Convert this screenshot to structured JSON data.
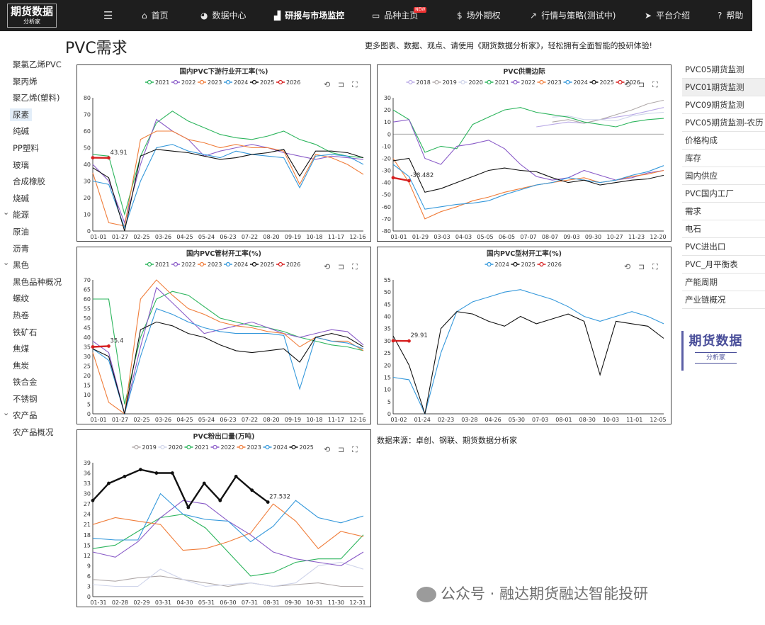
{
  "brand": {
    "line1": "期货数据",
    "line2": "分析家"
  },
  "nav": {
    "menu_icon": "hamburger-icon",
    "items": [
      {
        "label": "首页",
        "icon": "home-icon",
        "glyph": "⌂",
        "left": 200
      },
      {
        "label": "数据中心",
        "icon": "pie-icon",
        "glyph": "◕",
        "left": 283
      },
      {
        "label": "研报与市场监控",
        "icon": "bar-icon",
        "glyph": "▟",
        "left": 387
      },
      {
        "label": "品种主页",
        "icon": "book-icon",
        "glyph": "▭",
        "left": 525
      },
      {
        "label": "场外期权",
        "icon": "dollar-icon",
        "glyph": "$",
        "left": 645
      },
      {
        "label": "行情与策略(测试中)",
        "icon": "trend-icon",
        "glyph": "↗",
        "left": 748
      },
      {
        "label": "平台介绍",
        "icon": "send-icon",
        "glyph": "➤",
        "left": 910
      },
      {
        "label": "帮助",
        "icon": "help-icon",
        "glyph": "?",
        "left": 1013
      }
    ],
    "badge": "NEW"
  },
  "page": {
    "title": "PVC需求",
    "promo": "更多图表、数据、观点、请使用《期货数据分析家》，轻松拥有全面智能的投研体验!"
  },
  "left_nav": [
    {
      "label": "聚氯乙烯PVC"
    },
    {
      "label": "聚丙烯"
    },
    {
      "label": "聚乙烯(塑料)"
    },
    {
      "label": "尿素",
      "active": true
    },
    {
      "label": "纯碱"
    },
    {
      "label": "PP塑料"
    },
    {
      "label": "玻璃"
    },
    {
      "label": "合成橡胶"
    },
    {
      "label": "烧碱"
    },
    {
      "label": "能源",
      "group": true
    },
    {
      "label": "原油"
    },
    {
      "label": "沥青"
    },
    {
      "label": "黑色",
      "group": true
    },
    {
      "label": "黑色品种概况"
    },
    {
      "label": "螺纹"
    },
    {
      "label": "热卷"
    },
    {
      "label": "铁矿石"
    },
    {
      "label": "焦煤"
    },
    {
      "label": "焦炭"
    },
    {
      "label": "铁合金"
    },
    {
      "label": "不锈钢"
    },
    {
      "label": "农产品",
      "group": true
    },
    {
      "label": "农产品概况"
    }
  ],
  "right_nav": [
    {
      "label": "PVC05期货监测"
    },
    {
      "label": "PVC01期货监测",
      "selected": true
    },
    {
      "label": "PVC09期货监测"
    },
    {
      "label": "PVC05期货监测-农历"
    },
    {
      "label": "价格构成"
    },
    {
      "label": "库存"
    },
    {
      "label": "国内供应"
    },
    {
      "label": "PVC国内工厂"
    },
    {
      "label": "需求"
    },
    {
      "label": "电石"
    },
    {
      "label": "PVC进出口"
    },
    {
      "label": "PVC_月平衡表"
    },
    {
      "label": "产能周期"
    },
    {
      "label": "产业链概况"
    }
  ],
  "source_note": "数据来源：卓创、钢联、期货数据分析家",
  "watermark": "公众号 · 融达期货融达智能投研",
  "colors": {
    "2018": "#b9a9e6",
    "2019": "#b0a9a9",
    "2020": "#cfd4ea",
    "2021": "#2db55d",
    "2022": "#8a5cc8",
    "2023": "#f07d3a",
    "2024": "#3498db",
    "2025": "#111111",
    "2026": "#d62020"
  },
  "chart_data": [
    {
      "type": "line",
      "title": "国内PVC下游行业开工率(%)",
      "legend": [
        "2021",
        "2022",
        "2023",
        "2024",
        "2025",
        "2026"
      ],
      "xticks": [
        "01-01",
        "01-27",
        "02-25",
        "03-26",
        "04-25",
        "05-24",
        "06-23",
        "07-22",
        "08-20",
        "09-19",
        "10-18",
        "11-17",
        "12-16"
      ],
      "ylim": [
        0,
        80
      ],
      "yticks": [
        0,
        10,
        20,
        30,
        40,
        50,
        60,
        70,
        80
      ],
      "end_label": "43.91",
      "series": [
        {
          "name": "2021",
          "values": [
            46,
            45,
            10,
            45,
            65,
            72,
            66,
            62,
            58,
            56,
            55,
            57,
            60,
            55,
            52,
            47,
            45,
            44
          ]
        },
        {
          "name": "2022",
          "values": [
            40,
            30,
            5,
            40,
            67,
            60,
            55,
            45,
            48,
            50,
            52,
            50,
            47,
            45,
            43,
            45,
            44,
            43
          ]
        },
        {
          "name": "2023",
          "values": [
            35,
            5,
            3,
            55,
            60,
            60,
            55,
            53,
            50,
            52,
            50,
            50,
            48,
            28,
            46,
            44,
            40,
            34
          ]
        },
        {
          "name": "2024",
          "values": [
            30,
            28,
            2,
            30,
            50,
            52,
            48,
            46,
            44,
            48,
            46,
            45,
            44,
            26,
            45,
            46,
            45,
            40
          ]
        },
        {
          "name": "2025",
          "values": [
            38,
            32,
            0,
            45,
            49,
            48,
            47,
            45,
            43,
            44,
            46,
            47,
            49,
            33,
            48,
            48,
            47,
            44
          ]
        },
        {
          "name": "2026",
          "values": [
            44,
            43.91
          ]
        }
      ]
    },
    {
      "type": "line",
      "title": "PVC供需边际",
      "legend": [
        "2018",
        "2019",
        "2020",
        "2021",
        "2022",
        "2023",
        "2024",
        "2025",
        "2026"
      ],
      "xticks": [
        "01-01",
        "01-29",
        "03-03",
        "04-03",
        "05-05",
        "06-05",
        "07-07",
        "08-07",
        "09-03",
        "09-30",
        "10-27",
        "11-23",
        "12-20"
      ],
      "ylim": [
        -80,
        30
      ],
      "yticks": [
        30,
        20,
        10,
        0,
        -10,
        -20,
        -30,
        -40,
        -50,
        -60,
        -70,
        -80
      ],
      "end_label": "-38.482",
      "series": [
        {
          "name": "2018",
          "values": [
            null,
            null,
            null,
            null,
            null,
            null,
            null,
            null,
            null,
            6,
            8,
            10,
            9,
            12,
            14,
            16,
            19,
            22
          ]
        },
        {
          "name": "2019",
          "values": [
            null,
            null,
            null,
            null,
            null,
            null,
            null,
            null,
            null,
            null,
            10,
            12,
            9,
            12,
            16,
            20,
            25,
            28
          ]
        },
        {
          "name": "2020",
          "values": [
            null,
            null,
            null,
            null,
            null,
            null,
            null,
            null,
            null,
            null,
            14,
            15,
            12,
            12,
            11,
            15,
            17,
            18
          ]
        },
        {
          "name": "2021",
          "values": [
            20,
            12,
            -15,
            -10,
            -12,
            8,
            14,
            20,
            22,
            18,
            16,
            14,
            10,
            8,
            6,
            10,
            12,
            13
          ]
        },
        {
          "name": "2022",
          "values": [
            10,
            12,
            -20,
            -25,
            -10,
            -8,
            -5,
            -12,
            -25,
            -35,
            -38,
            -36,
            -30,
            -34,
            -38,
            -36,
            -32,
            -30
          ]
        },
        {
          "name": "2023",
          "values": [
            -20,
            -40,
            -70,
            -64,
            -60,
            -55,
            -52,
            -48,
            -45,
            -42,
            -40,
            -38,
            -36,
            -40,
            -38,
            -35,
            -33,
            -30
          ]
        },
        {
          "name": "2024",
          "values": [
            -25,
            -35,
            -62,
            -60,
            -58,
            -57,
            -55,
            -50,
            -46,
            -42,
            -40,
            -36,
            -38,
            -40,
            -38,
            -34,
            -31,
            -26
          ]
        },
        {
          "name": "2025",
          "values": [
            -22,
            -20,
            -48,
            -45,
            -40,
            -35,
            -30,
            -28,
            -30,
            -31,
            -36,
            -40,
            -38,
            -42,
            -40,
            -38,
            -37,
            -34
          ]
        },
        {
          "name": "2026",
          "values": [
            -36,
            -38.482
          ]
        }
      ]
    },
    {
      "type": "line",
      "title": "国内PVC管材开工率(%)",
      "legend": [
        "2021",
        "2022",
        "2023",
        "2024",
        "2025",
        "2026"
      ],
      "xticks": [
        "01-01",
        "01-27",
        "02-25",
        "03-26",
        "04-25",
        "05-24",
        "06-23",
        "07-22",
        "08-20",
        "09-19",
        "10-18",
        "11-17",
        "12-16"
      ],
      "ylim": [
        0,
        70
      ],
      "yticks": [
        0,
        5,
        10,
        15,
        20,
        25,
        30,
        35,
        40,
        45,
        50,
        55,
        60,
        65,
        70
      ],
      "end_label": "35.4",
      "series": [
        {
          "name": "2021",
          "values": [
            60,
            60,
            5,
            40,
            60,
            64,
            62,
            56,
            50,
            48,
            46,
            45,
            43,
            40,
            38,
            36,
            35,
            33
          ]
        },
        {
          "name": "2022",
          "values": [
            38,
            32,
            0,
            35,
            66,
            58,
            50,
            42,
            44,
            46,
            48,
            45,
            42,
            40,
            42,
            44,
            43,
            36
          ]
        },
        {
          "name": "2023",
          "values": [
            32,
            6,
            0,
            60,
            70,
            62,
            55,
            52,
            48,
            46,
            45,
            43,
            42,
            35,
            40,
            38,
            38,
            33
          ]
        },
        {
          "name": "2024",
          "values": [
            34,
            28,
            0,
            30,
            55,
            52,
            48,
            45,
            43,
            42,
            42,
            42,
            41,
            13,
            40,
            38,
            37,
            34
          ]
        },
        {
          "name": "2025",
          "values": [
            34,
            30,
            0,
            44,
            48,
            46,
            42,
            40,
            36,
            33,
            32,
            33,
            34,
            27,
            40,
            42,
            40,
            35
          ]
        },
        {
          "name": "2026",
          "values": [
            35,
            35.4
          ]
        }
      ]
    },
    {
      "type": "line",
      "title": "国内PVC型材开工率(%)",
      "legend": [
        "2024",
        "2025",
        "2026"
      ],
      "xticks": [
        "01-02",
        "01-24",
        "02-23",
        "03-28",
        "04-26",
        "05-30",
        "07-03",
        "08-01",
        "08-30",
        "10-03",
        "11-01",
        "12-05"
      ],
      "ylim": [
        0,
        55
      ],
      "yticks": [
        0,
        5,
        10,
        15,
        20,
        25,
        30,
        35,
        40,
        45,
        50,
        55
      ],
      "end_label": "29.91",
      "series": [
        {
          "name": "2024",
          "values": [
            15,
            14,
            0,
            25,
            42,
            46,
            48,
            50,
            51,
            49,
            47,
            44,
            40,
            38,
            40,
            42,
            40,
            37
          ]
        },
        {
          "name": "2025",
          "values": [
            32,
            20,
            0,
            35,
            42,
            41,
            38,
            36,
            40,
            37,
            39,
            41,
            38,
            16,
            38,
            37,
            36,
            31
          ]
        },
        {
          "name": "2026",
          "values": [
            30,
            29.91
          ]
        }
      ]
    },
    {
      "type": "line",
      "title": "PVC粉出口量(万吨)",
      "legend": [
        "2019",
        "2020",
        "2021",
        "2022",
        "2023",
        "2024",
        "2025"
      ],
      "xticks": [
        "01-31",
        "02-28",
        "02-29",
        "03-31",
        "04-30",
        "05-31",
        "06-30",
        "07-31",
        "08-31",
        "09-30",
        "10-31",
        "11-30",
        "12-31"
      ],
      "ylim": [
        0,
        39
      ],
      "yticks": [
        0,
        3,
        6,
        9,
        12,
        15,
        18,
        21,
        24,
        27,
        30,
        33,
        36,
        39
      ],
      "end_label": "27.532",
      "series": [
        {
          "name": "2019",
          "values": [
            5,
            4.5,
            5.5,
            6,
            5,
            4,
            3,
            4,
            3,
            3.5,
            4,
            3,
            3
          ]
        },
        {
          "name": "2020",
          "values": [
            3.5,
            3,
            3,
            8,
            5,
            3,
            3.5,
            4,
            3,
            4,
            9,
            10,
            8
          ]
        },
        {
          "name": "2021",
          "values": [
            14,
            15,
            19,
            23,
            24,
            20,
            13,
            6,
            7,
            10,
            11,
            11,
            18
          ]
        },
        {
          "name": "2022",
          "values": [
            13,
            11.5,
            16,
            23,
            28,
            27,
            22,
            18,
            13,
            11,
            10,
            9,
            13
          ]
        },
        {
          "name": "2023",
          "values": [
            21,
            23,
            22,
            21,
            13.5,
            14,
            16,
            18.5,
            27,
            22,
            14,
            19,
            17.5
          ]
        },
        {
          "name": "2024",
          "values": [
            17,
            16.5,
            16.5,
            30,
            24,
            22.5,
            22,
            16,
            20.5,
            28,
            23,
            21.5,
            23.5
          ]
        },
        {
          "name": "2025",
          "values": [
            28,
            33,
            35,
            37,
            36,
            36,
            26,
            33,
            28,
            35,
            31,
            27.532
          ]
        }
      ]
    }
  ]
}
